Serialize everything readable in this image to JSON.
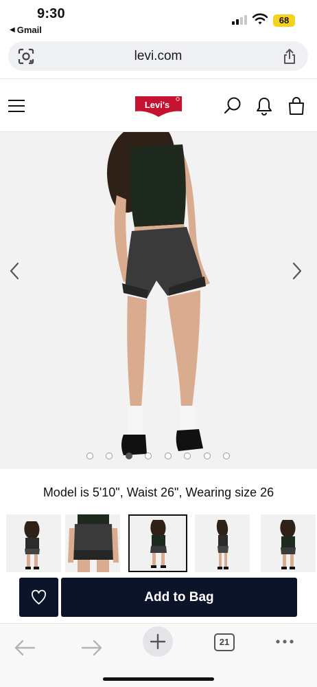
{
  "status_bar": {
    "time": "9:30",
    "back_app": "Gmail",
    "battery": "68"
  },
  "browser": {
    "url": "levi.com",
    "tabs_count": "21"
  },
  "header": {
    "logo_text": "Levi's",
    "icons": [
      "menu-icon",
      "search-icon",
      "bell-icon",
      "bag-icon"
    ]
  },
  "product": {
    "image_index": 3,
    "image_count": 8,
    "model_info": "Model is 5'10\", Waist 26\", Wearing size 26",
    "thumbnail_count": 5,
    "selected_thumbnail": 3
  },
  "actions": {
    "add_to_bag": "Add to Bag"
  },
  "colors": {
    "brand_red": "#c41230",
    "button_navy": "#0b1428",
    "battery_yellow": "#f5d31c"
  }
}
